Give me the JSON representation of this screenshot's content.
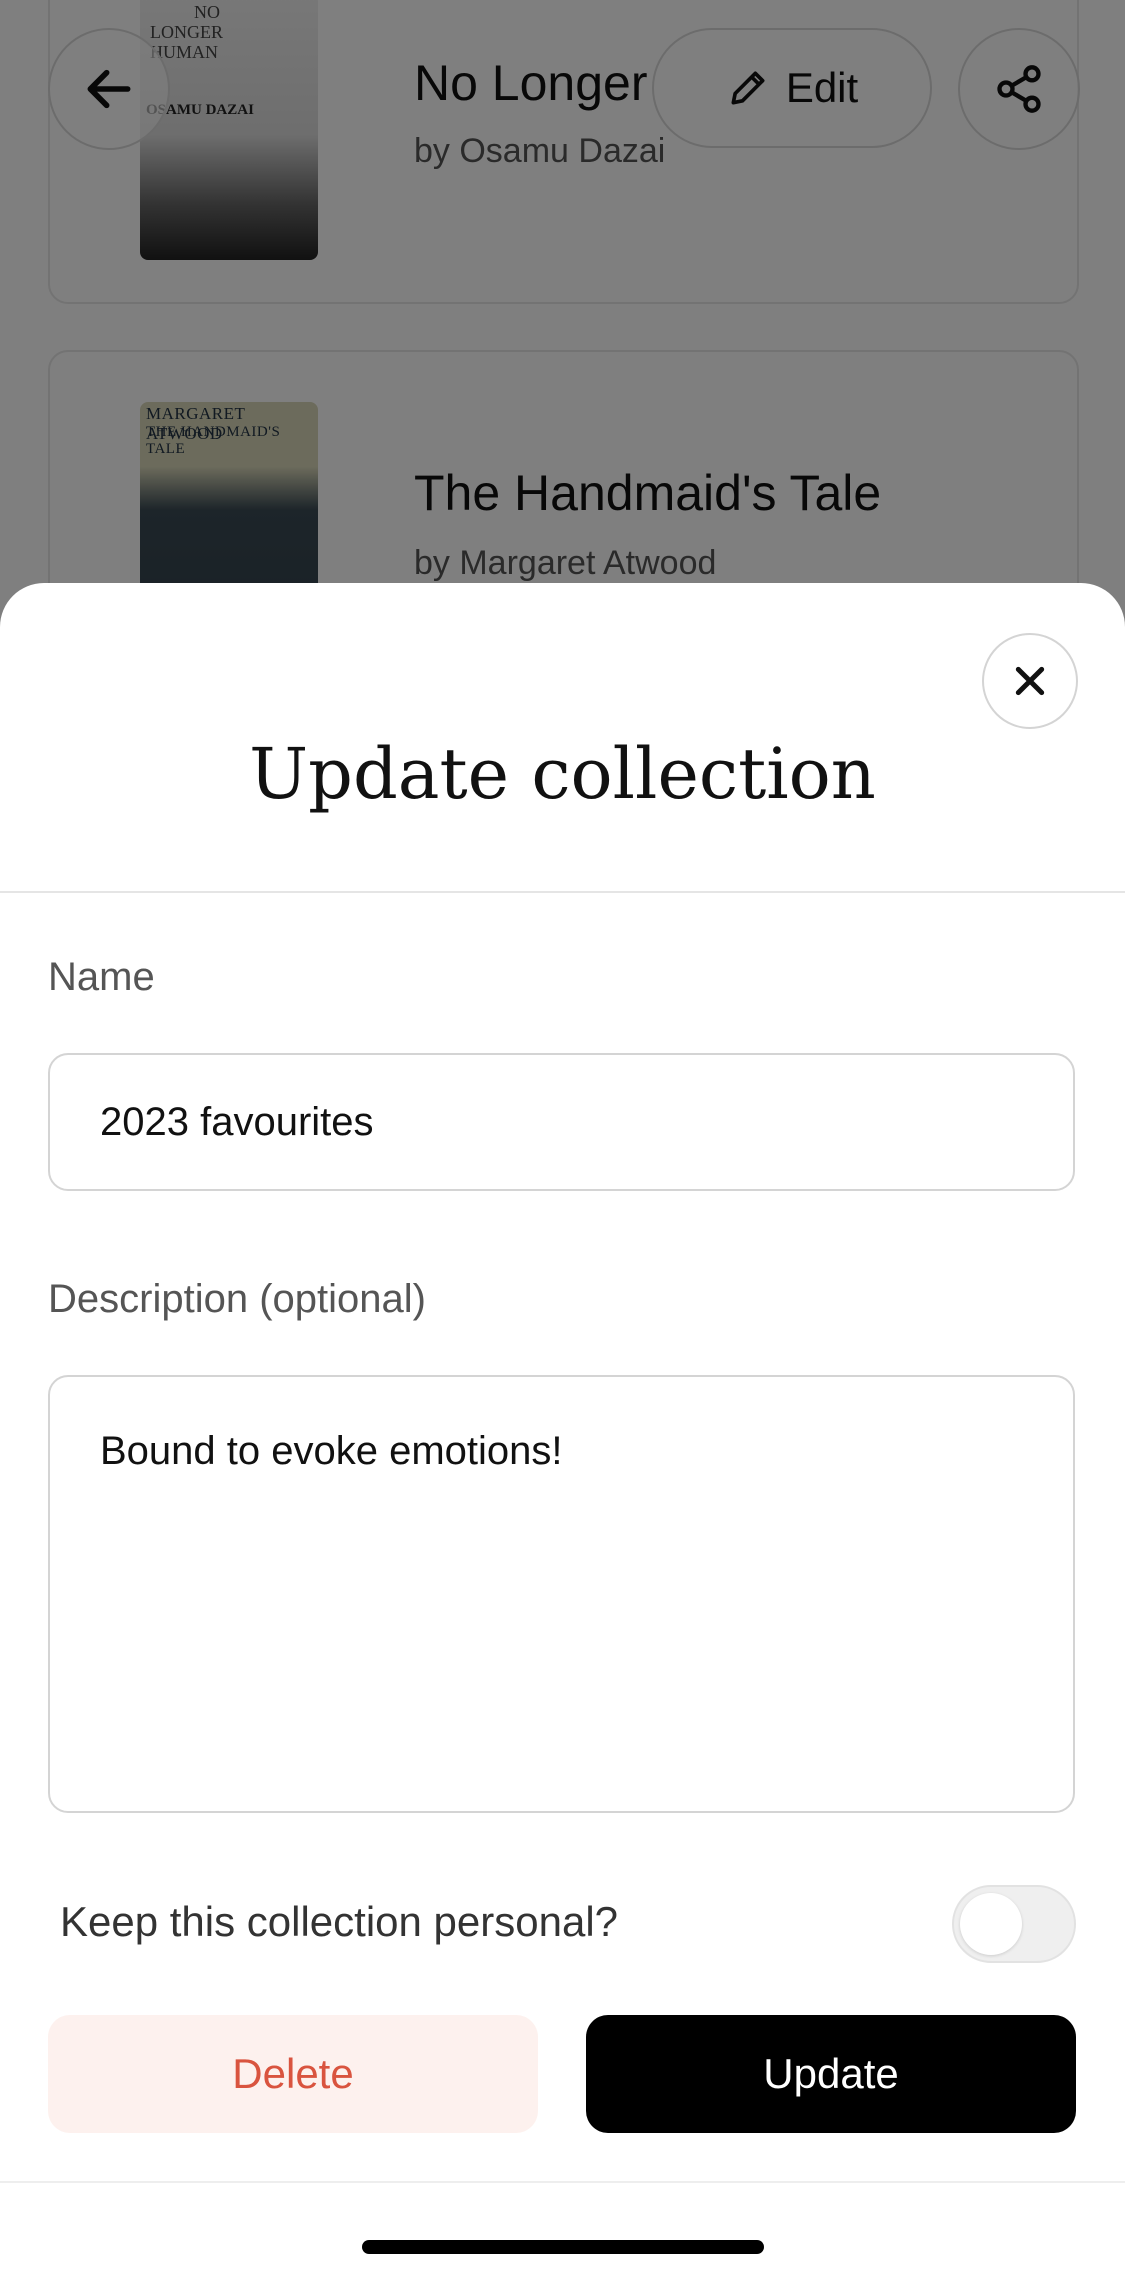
{
  "background_list": {
    "books": [
      {
        "title": "No Longer Human",
        "title_visible": "No Longer",
        "author": "by Osamu Dazai",
        "cover_text": [
          "NO",
          "LONGER",
          "HUMAN",
          "OSAMU DAZAI"
        ]
      },
      {
        "title": "The Handmaid's Tale",
        "author": "by Margaret Atwood",
        "cover_text": [
          "MARGARET ATWOOD",
          "THE HANDMAID'S TALE"
        ]
      }
    ],
    "header": {
      "edit_label": "Edit"
    }
  },
  "sheet": {
    "title": "Update collection",
    "name_label": "Name",
    "name_value": "2023 favourites",
    "description_label": "Description (optional)",
    "description_value": "Bound to evoke emotions!",
    "personal_label": "Keep this collection personal?",
    "personal_toggle_on": false,
    "delete_label": "Delete",
    "update_label": "Update"
  },
  "colors": {
    "delete_text": "#d9543f",
    "delete_bg": "#fdf1ee",
    "update_bg": "#000000"
  }
}
